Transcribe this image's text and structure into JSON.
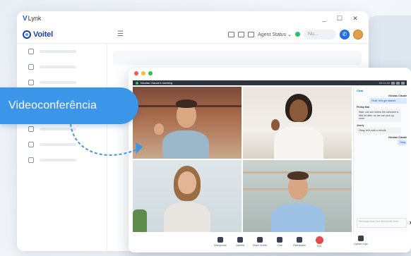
{
  "app": {
    "title_brand_mark": "V",
    "title": "Lynk",
    "brand": "Voitel",
    "agent_status_label": "Agent Status",
    "search_placeholder": "Nu...",
    "window_controls": [
      "_",
      "☐",
      "✕"
    ]
  },
  "sidebar": {
    "items": [
      "users-icon",
      "document-icon",
      "chat-icon",
      "phone-icon",
      "file-icon",
      "toggle-icon",
      "mic-icon",
      "list-icon"
    ]
  },
  "call": {
    "meeting_title": "Nicolas Claude's meeting",
    "clock": "00:11:40",
    "chat": {
      "title": "Chat",
      "messages": [
        {
          "name": "Nicolas Claude",
          "text": "Hi all, let's get started",
          "side": "out"
        },
        {
          "name": "Phillip Hall",
          "text": "Walt, can we review the schedule a little bit after, so we can pick up more",
          "side": "in"
        },
        {
          "name": "Jenny",
          "text": "Okay, let's wait a minute",
          "side": "in"
        },
        {
          "name": "Nicolas Claude",
          "text": "Okay",
          "side": "out"
        }
      ],
      "input_placeholder": "Message chat here and press enter"
    },
    "controls": [
      "Microphone",
      "Camera",
      "Share Screen",
      "Chat",
      "Participants",
      "End"
    ],
    "upload_label": "Upload Logo"
  },
  "label": {
    "text": "Videoconferência"
  },
  "colors": {
    "accent": "#3b95e8",
    "brand_blue": "#1f3fa3",
    "end_call": "#e5484d",
    "online": "#27c46a"
  }
}
